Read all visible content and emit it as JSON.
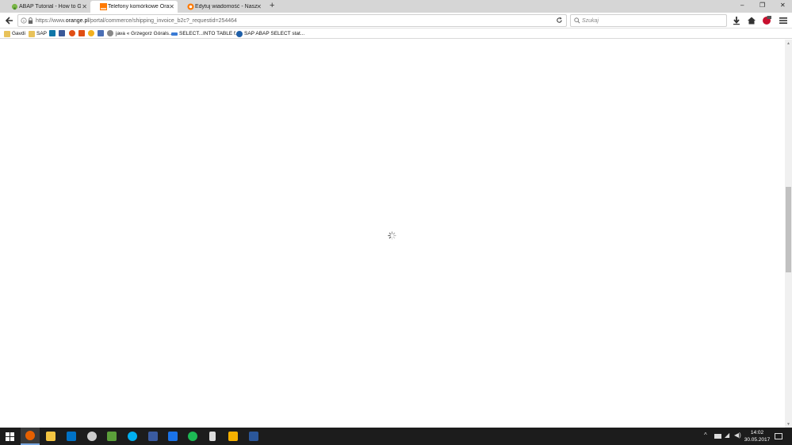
{
  "tabs": [
    {
      "label": "ABAP Tutorial - How to Gen",
      "icon": "bookmark-green-icon",
      "active": false
    },
    {
      "label": "Telefony komórkowe Orange",
      "icon": "orange-logo-icon",
      "active": true
    },
    {
      "label": "Edytuj wiadomość - Nasz Or",
      "icon": "orange-circle-icon",
      "active": false
    }
  ],
  "window_controls": {
    "minimize": "–",
    "maximize": "❐",
    "close": "✕"
  },
  "new_tab": "+",
  "address": {
    "prefix": "https://www.",
    "domain": "orange.pl",
    "path": "/portal/commerce/shipping_invoice_b2c?_requestid=254464"
  },
  "search": {
    "placeholder": "Szukaj"
  },
  "bookmarks": [
    {
      "label": "Gavdi",
      "icon": "folder-icon"
    },
    {
      "label": "SAP",
      "icon": "folder-icon"
    },
    {
      "label": "java « Grzegorz Górals...",
      "icon": "page-icon"
    },
    {
      "label": "SELECT...INTO TABLE f...",
      "icon": "sap-icon"
    },
    {
      "label": "SAP ABAP SELECT stat...",
      "icon": "s-icon"
    }
  ],
  "clock": {
    "time": "14:02",
    "date": "30.05.2017"
  },
  "colors": {
    "accent_orange": "#ff7900",
    "tabbar": "#d6d6d6",
    "taskbar": "#1c1c1c"
  }
}
